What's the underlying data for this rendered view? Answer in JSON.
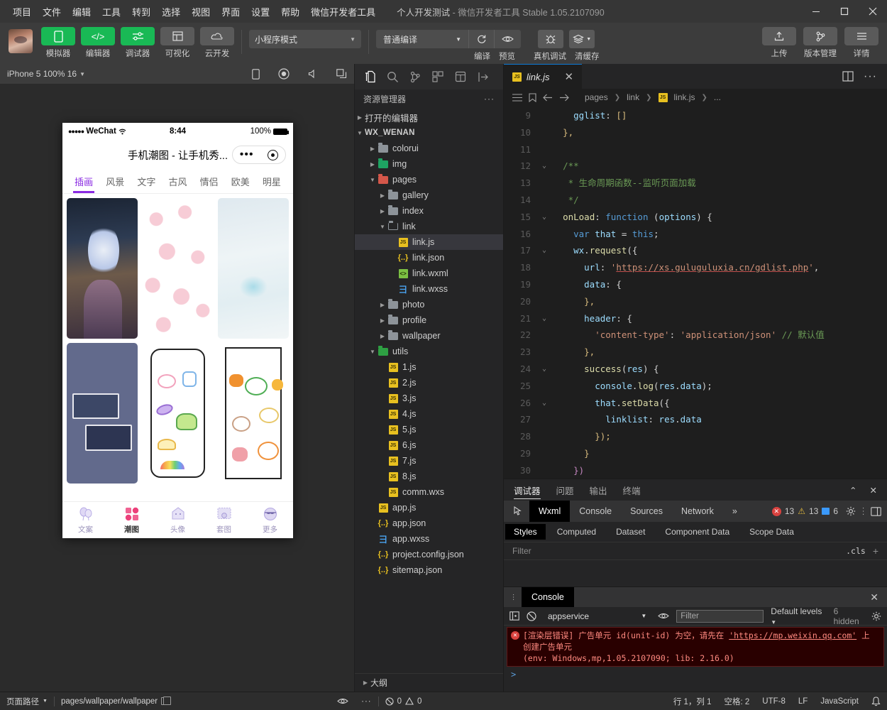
{
  "window": {
    "menus": [
      "项目",
      "文件",
      "编辑",
      "工具",
      "转到",
      "选择",
      "视图",
      "界面",
      "设置",
      "帮助",
      "微信开发者工具"
    ],
    "project_name": "个人开发测试",
    "title_suffix": "- 微信开发者工具 Stable 1.05.2107090",
    "controls": {
      "minimize": "—",
      "maximize": "▢",
      "close": "✕"
    }
  },
  "toolbar": {
    "left_buttons": [
      {
        "label": "模拟器",
        "icon": "phone-icon",
        "style": "green"
      },
      {
        "label": "编辑器",
        "icon": "code-icon",
        "style": "green"
      },
      {
        "label": "调试器",
        "icon": "debug-slider-icon",
        "style": "green"
      },
      {
        "label": "可视化",
        "icon": "layout-icon",
        "style": "grey"
      },
      {
        "label": "云开发",
        "icon": "cloud-icon",
        "style": "grey"
      }
    ],
    "mode_select": "小程序模式",
    "compile_select": "普通编译",
    "actions": [
      {
        "label": "编译",
        "icon": "refresh-icon"
      },
      {
        "label": "预览",
        "icon": "eye-icon"
      },
      {
        "label": "真机调试",
        "icon": "bug-icon"
      },
      {
        "label": "清缓存",
        "icon": "layers-icon"
      }
    ],
    "right_buttons": [
      {
        "label": "上传",
        "icon": "upload-icon"
      },
      {
        "label": "版本管理",
        "icon": "git-branch-icon"
      },
      {
        "label": "详情",
        "icon": "hamburger-icon"
      }
    ]
  },
  "simulator": {
    "device_label": "iPhone 5 100% 16",
    "tool_icons": [
      "rotate-device-icon",
      "record-icon",
      "volume-icon",
      "multi-window-icon"
    ],
    "status": {
      "carrier": "WeChat",
      "dots": "●●●●●",
      "time": "8:44",
      "battery": "100%"
    },
    "page_title": "手机潮图 - 让手机秀...",
    "capsule": {
      "dots": "•••",
      "circle": "target-icon"
    },
    "category_tabs": [
      "插画",
      "风景",
      "文字",
      "古风",
      "情侣",
      "欧美",
      "明星"
    ],
    "active_tab": "插画",
    "bottom_tabs": [
      {
        "label": "文案",
        "icon": "balloon-icon",
        "active": false
      },
      {
        "label": "潮图",
        "icon": "grid-icon",
        "active": true
      },
      {
        "label": "头像",
        "icon": "ghost-icon",
        "active": false
      },
      {
        "label": "套图",
        "icon": "album-icon",
        "active": false
      },
      {
        "label": "更多",
        "icon": "sunglasses-icon",
        "active": false
      }
    ]
  },
  "explorer": {
    "activity_icons": [
      "files-icon",
      "search-icon",
      "source-control-icon",
      "extensions-icon",
      "test-icon",
      "collapse-icon"
    ],
    "title": "资源管理器",
    "more": "···",
    "sections": {
      "open_editors": "打开的编辑器",
      "project_root": "WX_WENAN"
    },
    "tree": [
      {
        "label": "colorui",
        "type": "folder",
        "depth": 1,
        "expanded": false
      },
      {
        "label": "img",
        "type": "folder-green",
        "depth": 1,
        "expanded": false
      },
      {
        "label": "pages",
        "type": "folder-red",
        "depth": 1,
        "expanded": true
      },
      {
        "label": "gallery",
        "type": "folder",
        "depth": 2,
        "expanded": false
      },
      {
        "label": "index",
        "type": "folder",
        "depth": 2,
        "expanded": false
      },
      {
        "label": "link",
        "type": "folder-open",
        "depth": 2,
        "expanded": true
      },
      {
        "label": "link.js",
        "type": "js",
        "depth": 3,
        "selected": true
      },
      {
        "label": "link.json",
        "type": "json",
        "depth": 3
      },
      {
        "label": "link.wxml",
        "type": "wxml",
        "depth": 3
      },
      {
        "label": "link.wxss",
        "type": "wxss",
        "depth": 3
      },
      {
        "label": "photo",
        "type": "folder",
        "depth": 2,
        "expanded": false
      },
      {
        "label": "profile",
        "type": "folder",
        "depth": 2,
        "expanded": false
      },
      {
        "label": "wallpaper",
        "type": "folder",
        "depth": 2,
        "expanded": false
      },
      {
        "label": "utils",
        "type": "folder-green-open",
        "depth": 1,
        "expanded": true
      },
      {
        "label": "1.js",
        "type": "js",
        "depth": 2
      },
      {
        "label": "2.js",
        "type": "js",
        "depth": 2
      },
      {
        "label": "3.js",
        "type": "js",
        "depth": 2
      },
      {
        "label": "4.js",
        "type": "js",
        "depth": 2
      },
      {
        "label": "5.js",
        "type": "js",
        "depth": 2
      },
      {
        "label": "6.js",
        "type": "js",
        "depth": 2
      },
      {
        "label": "7.js",
        "type": "js",
        "depth": 2
      },
      {
        "label": "8.js",
        "type": "js",
        "depth": 2
      },
      {
        "label": "comm.wxs",
        "type": "js",
        "depth": 2
      },
      {
        "label": "app.js",
        "type": "js",
        "depth": 1
      },
      {
        "label": "app.json",
        "type": "json",
        "depth": 1
      },
      {
        "label": "app.wxss",
        "type": "wxss",
        "depth": 1
      },
      {
        "label": "project.config.json",
        "type": "json",
        "depth": 1
      },
      {
        "label": "sitemap.json",
        "type": "json",
        "depth": 1
      }
    ],
    "outline": "大纲"
  },
  "editor": {
    "tab": {
      "label": "link.js",
      "icon": "js-icon",
      "close": "✕"
    },
    "tab_right_icons": [
      "split-editor-icon",
      "more-actions-icon"
    ],
    "breadcrumb": [
      "pages",
      "link",
      "link.js",
      "..."
    ],
    "nav_icons": [
      "menu-icon",
      "bookmark-icon",
      "back-arrow-icon",
      "forward-arrow-icon"
    ],
    "first_line": 9,
    "lines": [
      {
        "n": 9,
        "fold": "",
        "html": "    <span class='pr'>gglist</span><span class='wh'>:</span> <span class='yl'>[]</span>"
      },
      {
        "n": 10,
        "fold": "",
        "html": "  <span class='yl'>},</span>"
      },
      {
        "n": 11,
        "fold": "",
        "html": ""
      },
      {
        "n": 12,
        "fold": "v",
        "html": "  <span class='cmt'>/**</span>"
      },
      {
        "n": 13,
        "fold": "",
        "html": "  <span class='cmt'> * 生命周期函数--监听页面加载</span>"
      },
      {
        "n": 14,
        "fold": "",
        "html": "  <span class='cmt'> */</span>"
      },
      {
        "n": 15,
        "fold": "v",
        "html": "  <span class='fn'>onLoad</span><span class='wh'>:</span> <span class='k'>function</span> <span class='wh'>(</span><span class='vr'>options</span><span class='wh'>) {</span>"
      },
      {
        "n": 16,
        "fold": "",
        "html": "    <span class='k'>var</span> <span class='vr'>that</span> <span class='wh'>=</span> <span class='k'>this</span><span class='wh'>;</span>"
      },
      {
        "n": 17,
        "fold": "v",
        "html": "    <span class='vr'>wx</span><span class='wh'>.</span><span class='fn'>request</span><span class='wh'>({</span>"
      },
      {
        "n": 18,
        "fold": "",
        "html": "      <span class='pr'>url</span><span class='wh'>:</span> <span class='str'>'</span><span class='str ul'>https://xs.guluguluxia.cn/gdlist.php</span><span class='str'>'</span><span class='wh'>,</span>"
      },
      {
        "n": 19,
        "fold": "",
        "html": "      <span class='pr'>data</span><span class='wh'>: {</span>"
      },
      {
        "n": 20,
        "fold": "",
        "html": "      <span class='yl'>},</span>"
      },
      {
        "n": 21,
        "fold": "v",
        "html": "      <span class='pr'>header</span><span class='wh'>: {</span>"
      },
      {
        "n": 22,
        "fold": "",
        "html": "        <span class='str'>'content-type'</span><span class='wh'>:</span> <span class='str'>'application/json'</span> <span class='cmt'>// 默认值</span>"
      },
      {
        "n": 23,
        "fold": "",
        "html": "      <span class='yl'>},</span>"
      },
      {
        "n": 24,
        "fold": "v",
        "html": "      <span class='fn'>success</span><span class='wh'>(</span><span class='vr'>res</span><span class='wh'>) {</span>"
      },
      {
        "n": 25,
        "fold": "",
        "html": "        <span class='vr'>console</span><span class='wh'>.</span><span class='fn'>log</span><span class='wh'>(</span><span class='vr'>res</span><span class='wh'>.</span><span class='pr'>data</span><span class='wh'>);</span>"
      },
      {
        "n": 26,
        "fold": "v",
        "html": "        <span class='vr'>that</span><span class='wh'>.</span><span class='fn'>setData</span><span class='wh'>({</span>"
      },
      {
        "n": 27,
        "fold": "",
        "html": "          <span class='pr'>linklist</span><span class='wh'>:</span> <span class='vr'>res</span><span class='wh'>.</span><span class='pr'>data</span>"
      },
      {
        "n": 28,
        "fold": "",
        "html": "        <span class='yl'>});</span>"
      },
      {
        "n": 29,
        "fold": "",
        "html": "      <span class='yl'>}</span>"
      },
      {
        "n": 30,
        "fold": "",
        "html": "    <span class='pu'>})</span>"
      }
    ]
  },
  "devtools": {
    "panel_tabs": [
      "调试器",
      "问题",
      "输出",
      "终端"
    ],
    "panel_active": "调试器",
    "panel_controls": [
      "collapse-icon",
      "close-icon"
    ],
    "dev_tabs": [
      "Wxml",
      "Console",
      "Sources",
      "Network"
    ],
    "dev_active": "Wxml",
    "overflow": "»",
    "counts": {
      "errors": "13",
      "warnings": "13",
      "info": "6"
    },
    "right_icons": [
      "gear-icon",
      "more-vertical-icon",
      "dock-icon"
    ],
    "style_tabs": [
      "Styles",
      "Computed",
      "Dataset",
      "Component Data",
      "Scope Data"
    ],
    "style_active": "Styles",
    "filter_placeholder": "Filter",
    "cls_label": ".cls",
    "plus": "+"
  },
  "console": {
    "title": "Console",
    "close": "✕",
    "context": "appservice",
    "filter_placeholder": "Filter",
    "levels": "Default levels",
    "hidden": "6 hidden",
    "icons": [
      "sidebar-icon",
      "clear-console-icon",
      "eye-icon",
      "gear-icon"
    ],
    "error": {
      "prefix": "[渲染层错误] 广告单元 id(unit-id) 为空，请先在 ",
      "link": "'https://mp.weixin.qq.com'",
      "suffix": " 上",
      "line2": "创建广告单元",
      "line3": "(env: Windows,mp,1.05.2107090; lib: 2.16.0)"
    },
    "prompt": ">"
  },
  "statusbar": {
    "page_path_label": "页面路径",
    "page_path": "pages/wallpaper/wallpaper",
    "copy_icon": "copy-icon",
    "eye_icon": "eye-icon",
    "more": "···",
    "problems": {
      "errors": "0",
      "warnings": "0"
    },
    "cursor": "行 1，列 1",
    "spaces": "空格: 2",
    "encoding": "UTF-8",
    "eol": "LF",
    "language": "JavaScript",
    "bell_icon": "bell-icon"
  },
  "colors": {
    "accent_green": "#19b955",
    "error_red": "#d9423f",
    "tab_purple": "#8a2be2",
    "link_blue": "#0d7ad6"
  }
}
